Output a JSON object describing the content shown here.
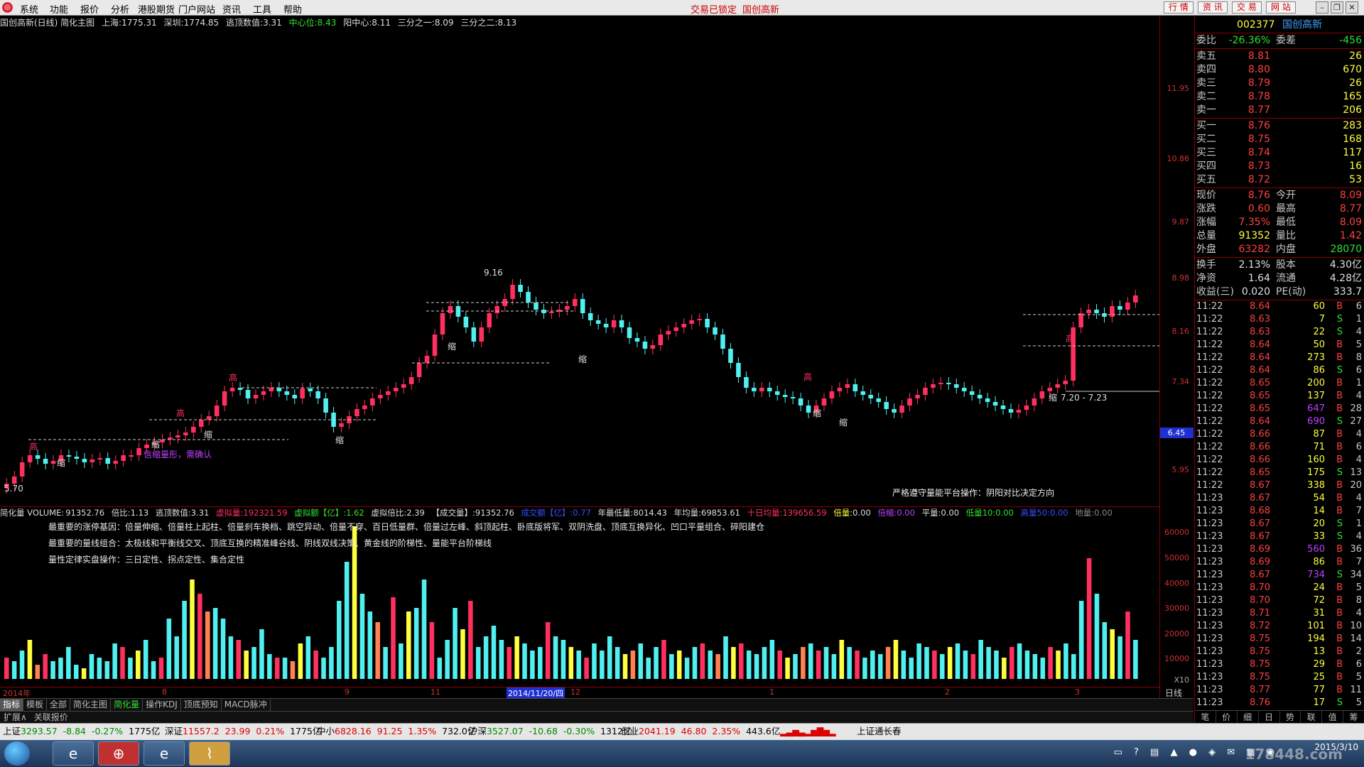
{
  "menubar": {
    "items": [
      "系统",
      "功能",
      "报价",
      "分析",
      "港股期货",
      "门户网站",
      "资讯",
      "工具",
      "帮助"
    ],
    "lock_status": "交易已锁定",
    "stock_title": "国创高新",
    "right_buttons": [
      "行 情",
      "资 讯",
      "交 易",
      "网 站"
    ],
    "window_buttons": [
      "–",
      "❐",
      "✕"
    ]
  },
  "chart_header": {
    "title": "国创高新(日线) 简化主图",
    "shanghai_label": "上海:",
    "shanghai_value": "1775.31",
    "shenzhen_label": "深圳:",
    "shenzhen_value": "1774.85",
    "escape_label": "逃顶数值:",
    "escape_value": "3.31",
    "center_label": "中心位:",
    "center_value": "8.43",
    "yang_label": "阳中心:",
    "yang_value": "8.11",
    "third1_label": "三分之一:",
    "third1_value": "8.09",
    "third2_label": "三分之二:",
    "third2_value": "8.13"
  },
  "main_chart": {
    "annotations": {
      "high_marker": "高",
      "shrink_marker": "缩",
      "peak_price": "9.16",
      "low_price": "5.70",
      "confirm_note": "信缩量形，需确认",
      "range_label": "7.20 - 7.23",
      "advice": "严格遵守量能平台操作：阴阳对比决定方向",
      "current_price_tag": "6.45"
    }
  },
  "price_axis": {
    "labels": [
      "11.95",
      "10.86",
      "9.87",
      "8.98",
      "8.16",
      "7.34",
      "5.95"
    ],
    "vol_labels": [
      "60000",
      "50000",
      "40000",
      "30000",
      "20000",
      "10000",
      "X10"
    ]
  },
  "vol_header": {
    "title": "简化量 VOLUME:",
    "volume": "91352.76",
    "ratio_label": "倍比:",
    "ratio": "1.13",
    "escape_label": "逃顶数值:",
    "escape": "3.31",
    "virtual_vol_label": "虚拟量:",
    "virtual_vol": "192321.59",
    "virtual_amt_label": "虚拟额【亿】:",
    "virtual_amt": "1.62",
    "virtual_ratio_label": "虚拟倍比:",
    "virtual_ratio": "2.39",
    "deal_label": "【成交量】:",
    "deal": "91352.76",
    "amount_label": "成交额【亿】:",
    "amount": "0.77",
    "year_low_label": "年最低量:",
    "year_low": "8014.43",
    "year_avg_label": "年均量:",
    "year_avg": "69853.61",
    "ten_avg_label": "十日均量:",
    "ten_avg": "139656.59",
    "double_label": "倍量:",
    "double": "0.00",
    "shrink_label": "倍缩:",
    "shrink": "0.00",
    "flat_label": "平量:",
    "flat": "0.00",
    "low10_label": "低量10:",
    "low10": "0.00",
    "high50_label": "高量50:",
    "high50": "0.00",
    "ground_label": "地量:",
    "ground": "0.00"
  },
  "vol_notes": [
    "最重要的涨停基因：倍量伸缩、倍量柱上起柱、倍量刹车换档、跳空异动、倍量不穿、百日低量群、倍量过左峰、斜顶起柱、卧底版将军、双阴洗盘、顶底互换异化、凹口平量组合、碎阳建仓",
    "最重要的量线组合：太极线和平衡线交叉、顶底互换的精准峰谷线、阴线双线决策、黄金线的阶梯性、量能平台阶梯线",
    "量性定律实盘操作：三日定性、拐点定性、集合定性"
  ],
  "date_axis": {
    "labels": [
      "2014年",
      "8",
      "9",
      "11",
      "2014/11/20/四",
      "12",
      "1",
      "2",
      "3"
    ]
  },
  "bottom_tabs": {
    "main": [
      "指标",
      "模板",
      "全部",
      "简化主图",
      "简化量",
      "操作KDJ",
      "顶底预知",
      "MACD脉冲"
    ],
    "sub": [
      "扩展∧",
      "关联报价"
    ],
    "period": "日线"
  },
  "right_panel": {
    "code": "002377",
    "name": "国创高新",
    "commission": {
      "ratio_label": "委比",
      "ratio": "-26.36%",
      "diff_label": "委差",
      "diff": "-456"
    },
    "asks": [
      {
        "label": "卖五",
        "price": "8.81",
        "vol": "26"
      },
      {
        "label": "卖四",
        "price": "8.80",
        "vol": "670"
      },
      {
        "label": "卖三",
        "price": "8.79",
        "vol": "26"
      },
      {
        "label": "卖二",
        "price": "8.78",
        "vol": "165"
      },
      {
        "label": "卖一",
        "price": "8.77",
        "vol": "206"
      }
    ],
    "bids": [
      {
        "label": "买一",
        "price": "8.76",
        "vol": "283"
      },
      {
        "label": "买二",
        "price": "8.75",
        "vol": "168"
      },
      {
        "label": "买三",
        "price": "8.74",
        "vol": "117"
      },
      {
        "label": "买四",
        "price": "8.73",
        "vol": "16"
      },
      {
        "label": "买五",
        "price": "8.72",
        "vol": "53"
      }
    ],
    "quote": [
      {
        "l1": "现价",
        "v1": "8.76",
        "l2": "今开",
        "v2": "8.09"
      },
      {
        "l1": "涨跌",
        "v1": "0.60",
        "l2": "最高",
        "v2": "8.77"
      },
      {
        "l1": "涨幅",
        "v1": "7.35%",
        "l2": "最低",
        "v2": "8.09"
      },
      {
        "l1": "总量",
        "v1": "91352",
        "l2": "量比",
        "v2": "1.42"
      },
      {
        "l1": "外盘",
        "v1": "63282",
        "l2": "内盘",
        "v2": "28070"
      }
    ],
    "fundamentals": [
      {
        "l1": "换手",
        "v1": "2.13%",
        "l2": "股本",
        "v2": "4.30亿"
      },
      {
        "l1": "净资",
        "v1": "1.64",
        "l2": "流通",
        "v2": "4.28亿"
      },
      {
        "l1": "收益(三)",
        "v1": "0.020",
        "l2": "PE(动)",
        "v2": "333.7"
      }
    ],
    "ticks": [
      {
        "t": "11:22",
        "p": "8.64",
        "v": "60",
        "s": "B",
        "n": "6"
      },
      {
        "t": "11:22",
        "p": "8.63",
        "v": "7",
        "s": "S",
        "n": "1"
      },
      {
        "t": "11:22",
        "p": "8.63",
        "v": "22",
        "s": "S",
        "n": "4"
      },
      {
        "t": "11:22",
        "p": "8.64",
        "v": "50",
        "s": "B",
        "n": "5"
      },
      {
        "t": "11:22",
        "p": "8.64",
        "v": "273",
        "s": "B",
        "n": "8"
      },
      {
        "t": "11:22",
        "p": "8.64",
        "v": "86",
        "s": "S",
        "n": "6"
      },
      {
        "t": "11:22",
        "p": "8.65",
        "v": "200",
        "s": "B",
        "n": "1"
      },
      {
        "t": "11:22",
        "p": "8.65",
        "v": "137",
        "s": "B",
        "n": "4"
      },
      {
        "t": "11:22",
        "p": "8.65",
        "v": "647",
        "s": "B",
        "n": "28"
      },
      {
        "t": "11:22",
        "p": "8.64",
        "v": "690",
        "s": "S",
        "n": "27"
      },
      {
        "t": "11:22",
        "p": "8.66",
        "v": "87",
        "s": "B",
        "n": "4"
      },
      {
        "t": "11:22",
        "p": "8.66",
        "v": "71",
        "s": "B",
        "n": "6"
      },
      {
        "t": "11:22",
        "p": "8.66",
        "v": "160",
        "s": "B",
        "n": "4"
      },
      {
        "t": "11:22",
        "p": "8.65",
        "v": "175",
        "s": "S",
        "n": "13"
      },
      {
        "t": "11:22",
        "p": "8.67",
        "v": "338",
        "s": "B",
        "n": "20"
      },
      {
        "t": "11:23",
        "p": "8.67",
        "v": "54",
        "s": "B",
        "n": "4"
      },
      {
        "t": "11:23",
        "p": "8.68",
        "v": "14",
        "s": "B",
        "n": "7"
      },
      {
        "t": "11:23",
        "p": "8.67",
        "v": "20",
        "s": "S",
        "n": "1"
      },
      {
        "t": "11:23",
        "p": "8.67",
        "v": "33",
        "s": "S",
        "n": "4"
      },
      {
        "t": "11:23",
        "p": "8.69",
        "v": "560",
        "s": "B",
        "n": "36"
      },
      {
        "t": "11:23",
        "p": "8.69",
        "v": "86",
        "s": "B",
        "n": "7"
      },
      {
        "t": "11:23",
        "p": "8.67",
        "v": "734",
        "s": "S",
        "n": "34"
      },
      {
        "t": "11:23",
        "p": "8.70",
        "v": "24",
        "s": "B",
        "n": "5"
      },
      {
        "t": "11:23",
        "p": "8.70",
        "v": "72",
        "s": "B",
        "n": "8"
      },
      {
        "t": "11:23",
        "p": "8.71",
        "v": "31",
        "s": "B",
        "n": "4"
      },
      {
        "t": "11:23",
        "p": "8.72",
        "v": "101",
        "s": "B",
        "n": "10"
      },
      {
        "t": "11:23",
        "p": "8.75",
        "v": "194",
        "s": "B",
        "n": "14"
      },
      {
        "t": "11:23",
        "p": "8.75",
        "v": "13",
        "s": "B",
        "n": "2"
      },
      {
        "t": "11:23",
        "p": "8.75",
        "v": "29",
        "s": "B",
        "n": "6"
      },
      {
        "t": "11:23",
        "p": "8.75",
        "v": "25",
        "s": "B",
        "n": "5"
      },
      {
        "t": "11:23",
        "p": "8.77",
        "v": "77",
        "s": "B",
        "n": "11"
      },
      {
        "t": "11:23",
        "p": "8.76",
        "v": "17",
        "s": "S",
        "n": "5"
      }
    ],
    "bottom_tabs": [
      "笔",
      "价",
      "细",
      "日",
      "势",
      "联",
      "值",
      "筹"
    ]
  },
  "statusbar": {
    "sh_name": "上证",
    "sh_val": "3293.57",
    "sh_chg": "-8.84",
    "sh_pct": "-0.27%",
    "sh_amt": "1775亿",
    "sz_name": "深证",
    "sz_val": "11557.2",
    "sz_chg": "23.99",
    "sz_pct": "0.21%",
    "sz_amt": "1775亿",
    "zx_name": "中小",
    "zx_val": "6828.16",
    "zx_chg": "91.25",
    "zx_pct": "1.35%",
    "zx_amt": "732.0亿",
    "hs_name": "沪深",
    "hs_val": "3527.07",
    "hs_chg": "-10.68",
    "hs_pct": "-0.30%",
    "hs_amt": "1312亿",
    "cy_name": "创业",
    "cy_val": "2041.19",
    "cy_chg": "46.80",
    "cy_pct": "2.35%",
    "cy_amt": "443.6亿",
    "ticker": "上证通长春"
  },
  "taskbar": {
    "watermark": "178448.com",
    "time": "2015/3/10"
  },
  "colors": {
    "up_candle": "#ff3060",
    "down_candle": "#50f0f0",
    "axis_red": "#d03030",
    "grid_red": "#800000"
  }
}
